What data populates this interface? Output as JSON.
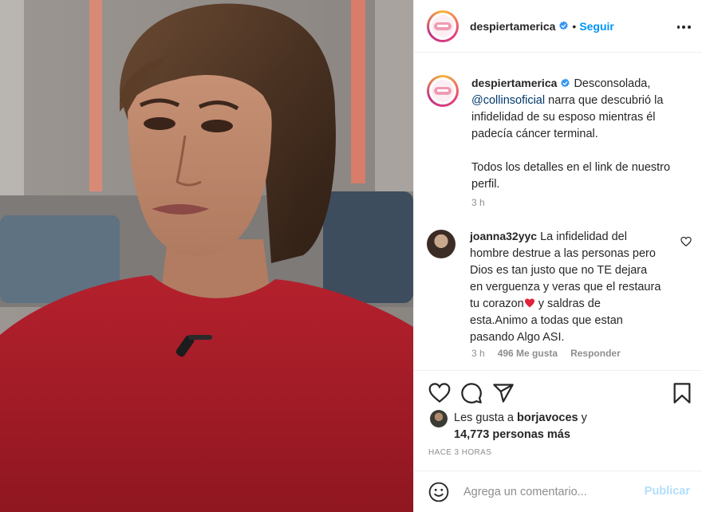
{
  "post": {
    "username": "despiertamerica",
    "follow_label": "Seguir",
    "dot": "•",
    "verified_icon": "verified-badge-icon"
  },
  "caption": {
    "username": "despiertamerica",
    "line_before_mention": "Desconsolada,",
    "mention": "@collinsoficial",
    "line_after_mention": "narra que descubrió la infidelidad de su esposo mientras él padecía cáncer terminal.",
    "paragraph2": "Todos los detalles en el link de nuestro perfil.",
    "time": "3 h"
  },
  "comment": {
    "username": "joanna32yyc",
    "text_part1": "La infidelidad del hombre destrue a las personas pero Dios es tan justo que no TE dejara en verguenza y veras que el restaura tu corazon",
    "text_part2": "y saldras de esta.Animo a todas que estan pasando Algo ASI.",
    "time": "3 h",
    "likes": "496 Me gusta",
    "reply": "Responder"
  },
  "likes": {
    "prefix": "Les gusta a",
    "user": "borjavoces",
    "joiner": "y",
    "count": "14,773 personas más"
  },
  "time_ago": "HACE 3 HORAS",
  "comment_box": {
    "placeholder": "Agrega un comentario...",
    "publish": "Publicar"
  },
  "colors": {
    "link": "#0095f6",
    "mention": "#00376b",
    "muted": "#8e8e8e",
    "publish_disabled": "#b2dffc",
    "heart": "#e0243a"
  },
  "icons": [
    "more-options-icon",
    "heart-icon",
    "comment-icon",
    "share-icon",
    "bookmark-icon",
    "smiley-icon",
    "red-heart-emoji"
  ]
}
